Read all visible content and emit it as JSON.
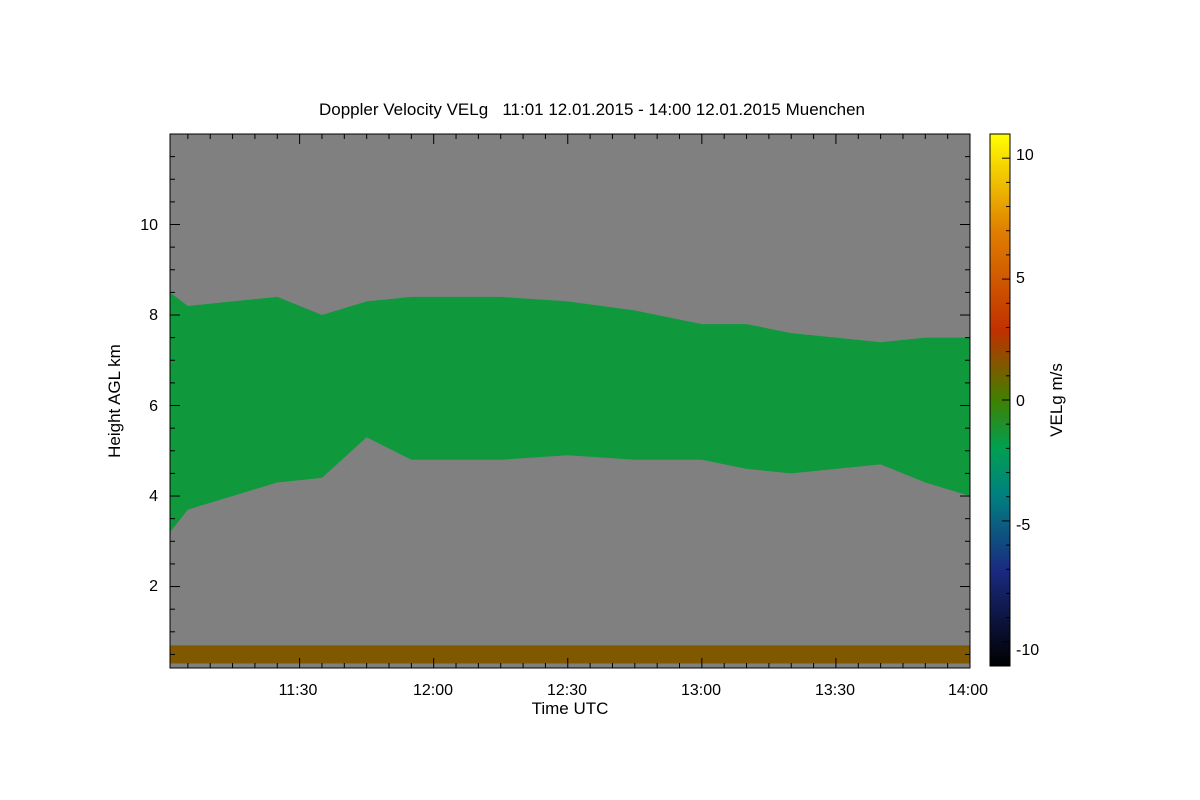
{
  "chart_data": {
    "type": "heatmap",
    "title": "Doppler Velocity VELg   11:01 12.01.2015 - 14:00 12.01.2015 Muenchen",
    "xlabel": "Time UTC",
    "ylabel": "Height AGL km",
    "xlim": [
      "11:01",
      "14:00"
    ],
    "ylim": [
      0.2,
      12.0
    ],
    "x_tick_labels": [
      "11:30",
      "12:00",
      "12:30",
      "13:00",
      "13:30",
      "14:00"
    ],
    "y_tick_labels": [
      "2",
      "4",
      "6",
      "8",
      "10"
    ],
    "colorbar": {
      "label": "VELg m/s",
      "range": [
        -11,
        11
      ],
      "tick_labels": [
        "10",
        "5",
        "0",
        "-5",
        "-10"
      ],
      "colors": {
        "-11": "#000000",
        "-7": "#1a2a80",
        "-4": "#008080",
        "-2": "#00a050",
        "0": "#408000",
        "3": "#c03000",
        "7": "#e08000",
        "11": "#ffff00"
      }
    },
    "background_color": "#808080",
    "cloud_layer": {
      "time": [
        "11:01",
        "11:05",
        "11:15",
        "11:25",
        "11:35",
        "11:45",
        "11:55",
        "12:05",
        "12:15",
        "12:30",
        "12:45",
        "13:00",
        "13:10",
        "13:20",
        "13:30",
        "13:40",
        "13:50",
        "14:00"
      ],
      "top_km": [
        8.5,
        8.2,
        8.3,
        8.4,
        8.0,
        8.3,
        8.4,
        8.4,
        8.4,
        8.3,
        8.1,
        7.8,
        7.8,
        7.6,
        7.5,
        7.4,
        7.5,
        7.5
      ],
      "base_km": [
        3.2,
        3.7,
        4.0,
        4.3,
        4.4,
        5.3,
        4.8,
        4.8,
        4.8,
        4.9,
        4.8,
        4.8,
        4.6,
        4.5,
        4.6,
        4.7,
        4.3,
        4.0
      ],
      "velocity_ms": -1.5
    },
    "near_ground_layer": {
      "bottom_km": 0.3,
      "top_km": 0.7,
      "velocity_ms": 1.5
    }
  }
}
